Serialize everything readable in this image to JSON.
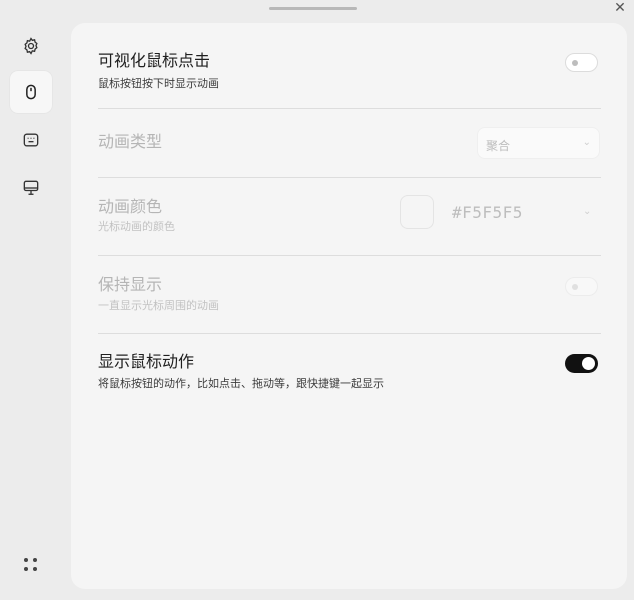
{
  "window": {
    "close_icon": "close-icon"
  },
  "sidebar": {
    "items": [
      {
        "name": "settings",
        "icon": "gear-icon",
        "active": false
      },
      {
        "name": "mouse",
        "icon": "mouse-icon",
        "active": true
      },
      {
        "name": "keyboard",
        "icon": "keyboard-icon",
        "active": false
      },
      {
        "name": "display",
        "icon": "monitor-icon",
        "active": false
      }
    ],
    "bottom_icon": "grid-dots-icon"
  },
  "settings": {
    "click_visual": {
      "title": "可视化鼠标点击",
      "subtitle": "鼠标按钮按下时显示动画",
      "enabled": false
    },
    "animation_type": {
      "title": "动画类型",
      "value": "聚合"
    },
    "animation_color": {
      "title": "动画颜色",
      "subtitle": "光标动画的颜色",
      "value": "#F5F5F5"
    },
    "keep_showing": {
      "title": "保持显示",
      "subtitle": "一直显示光标周围的动画",
      "enabled": false
    },
    "show_mouse_actions": {
      "title": "显示鼠标动作",
      "subtitle": "将鼠标按钮的动作，比如点击、拖动等，跟快捷键一起显示",
      "enabled": true
    }
  },
  "colors": {
    "background": "#ececec",
    "panel": "#f5f5f5",
    "toggle_on": "#111111"
  }
}
